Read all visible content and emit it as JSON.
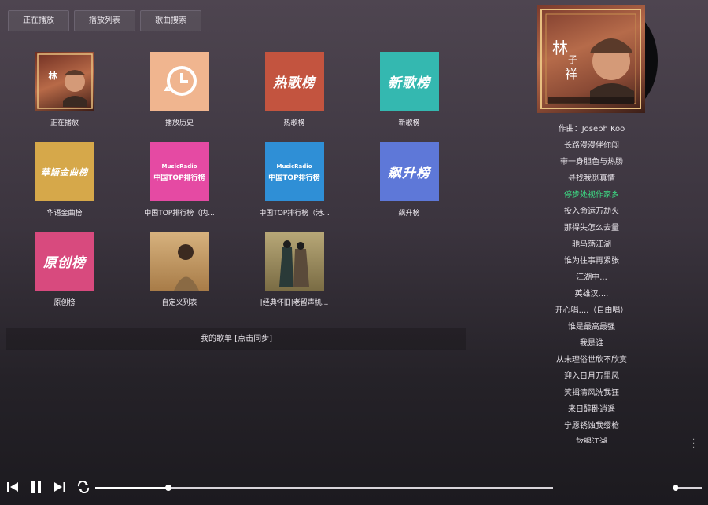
{
  "tabs": [
    "正在播放",
    "播放列表",
    "歌曲搜索"
  ],
  "cards": [
    {
      "label": "正在播放",
      "cover_text": "林",
      "color": "#8a3a28"
    },
    {
      "label": "播放历史",
      "cover_text": "",
      "color": "#f0b58f"
    },
    {
      "label": "热歌榜",
      "cover_text": "热歌榜",
      "color": "#c3543f"
    },
    {
      "label": "新歌榜",
      "cover_text": "新歌榜",
      "color": "#34b8b0"
    },
    {
      "label": "华语金曲榜",
      "cover_text": "華語金曲榜",
      "color": "#d6a84a"
    },
    {
      "label": "中国TOP排行榜（内...",
      "cover_text": "中国TOP排行榜",
      "sub": "MusicRadio",
      "color": "#e54aa3"
    },
    {
      "label": "中国TOP排行榜（港...",
      "cover_text": "中国TOP排行榜",
      "sub": "MusicRadio",
      "color": "#2f8fd6"
    },
    {
      "label": "飙升榜",
      "cover_text": "飙升榜",
      "color": "#5e78d8"
    },
    {
      "label": "原创榜",
      "cover_text": "原创榜",
      "color": "#d84a7e"
    },
    {
      "label": "自定义列表",
      "cover_text": "",
      "color": "#c89a63"
    },
    {
      "label": "|经典怀旧|老留声机...",
      "cover_text": "",
      "color": "#9c8c5e"
    }
  ],
  "my_playlist": "我的歌单 [点击同步]",
  "album": {
    "artist_chars": "林 子 祥",
    "color": "#a4553d"
  },
  "lyrics": {
    "lines": [
      "作曲：Joseph Koo",
      "长路漫漫伴你闯",
      "带一身胆色与热肠",
      "寻找我觅真情",
      "停步处视作家乡",
      "投入命运万劫火",
      "那得失怎么去量",
      "驰马荡江湖",
      "谁为往事再紧张",
      "江湖中...",
      "英雄汉....",
      "开心唱....（自由唱）",
      "谁是最高最强",
      "我是谁",
      "从未理俗世欣不欣赏",
      "迎入日月万里风",
      "笑揖清风洗我狂",
      "来日醉卧逍遥",
      "宁愿锈蚀我缨枪",
      "放眼江湖"
    ],
    "current_index": 4,
    "current_color": "#3ddc84"
  },
  "player": {
    "progress": 0.16,
    "volume": 0.0,
    "icons": [
      "prev-icon",
      "pause-icon",
      "next-icon",
      "repeat-icon"
    ]
  }
}
